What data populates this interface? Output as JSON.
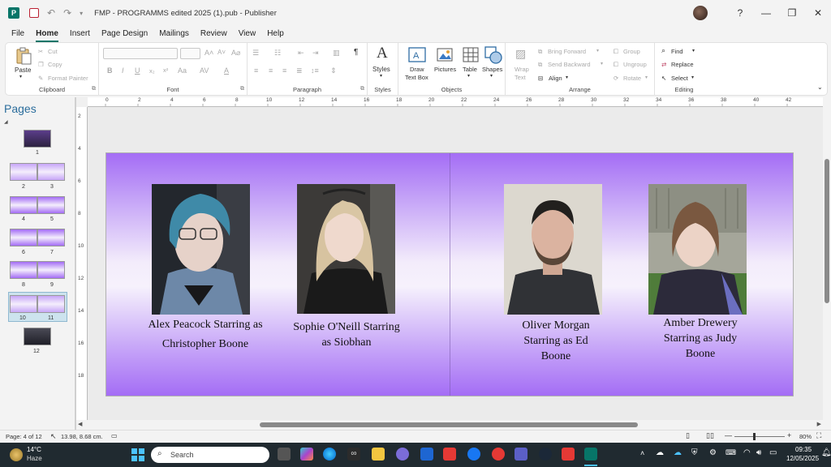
{
  "window": {
    "title": "FMP - PROGRAMMS edited 2025 (1).pub - Publisher",
    "app_glyph": "P",
    "help": "?"
  },
  "tabs": [
    "File",
    "Home",
    "Insert",
    "Page Design",
    "Mailings",
    "Review",
    "View",
    "Help"
  ],
  "ribbon": {
    "clipboard": {
      "label": "Clipboard",
      "paste": "Paste",
      "cut": "Cut",
      "copy": "Copy",
      "format_painter": "Format Painter"
    },
    "font": {
      "label": "Font"
    },
    "paragraph": {
      "label": "Paragraph"
    },
    "styles": {
      "label": "Styles",
      "button": "Styles"
    },
    "objects": {
      "label": "Objects",
      "draw_text_box_1": "Draw",
      "draw_text_box_2": "Text Box",
      "pictures": "Pictures",
      "table": "Table",
      "shapes": "Shapes"
    },
    "arrange": {
      "label": "Arrange",
      "wrap_1": "Wrap",
      "wrap_2": "Text",
      "bring_forward": "Bring Forward",
      "send_backward": "Send Backward",
      "align": "Align",
      "group": "Group",
      "ungroup": "Ungroup",
      "rotate": "Rotate"
    },
    "editing": {
      "label": "Editing",
      "find": "Find",
      "replace": "Replace",
      "select": "Select"
    }
  },
  "pages_pane": {
    "title": "Pages",
    "page_numbers": [
      "1",
      "2",
      "3",
      "4",
      "5",
      "6",
      "7",
      "8",
      "9",
      "10",
      "11",
      "12"
    ]
  },
  "ruler": {
    "h_ticks": [
      "0",
      "2",
      "4",
      "6",
      "8",
      "10",
      "12",
      "14",
      "16",
      "18",
      "20",
      "22",
      "24",
      "26",
      "28",
      "30",
      "32",
      "34",
      "36",
      "38",
      "40",
      "42"
    ],
    "v_ticks": [
      "2",
      "4",
      "6",
      "8",
      "10",
      "12",
      "14",
      "16",
      "18"
    ]
  },
  "cast": [
    {
      "caption_1": "Alex Peacock Starring as",
      "caption_2": "Christopher Boone"
    },
    {
      "caption_1": "Sophie O'Neill Starring",
      "caption_2": "as Siobhan"
    },
    {
      "caption_1": "Oliver Morgan",
      "caption_2": "Starring as Ed",
      "caption_3": "Boone"
    },
    {
      "caption_1": "Amber Drewery",
      "caption_2": "Starring as Judy",
      "caption_3": "Boone"
    }
  ],
  "status": {
    "page": "Page: 4 of 12",
    "position": "13.98, 8.68 cm.",
    "zoom": "80%"
  },
  "taskbar": {
    "temperature": "14°C",
    "weather": "Haze",
    "search_placeholder": "Search",
    "time": "09:35",
    "date": "12/05/2025"
  },
  "colors": {
    "accent": "#077568",
    "page_gradient_edge": "#a46df5",
    "page_gradient_center": "#f6f1fc",
    "pages_title": "#2b6d9c"
  }
}
